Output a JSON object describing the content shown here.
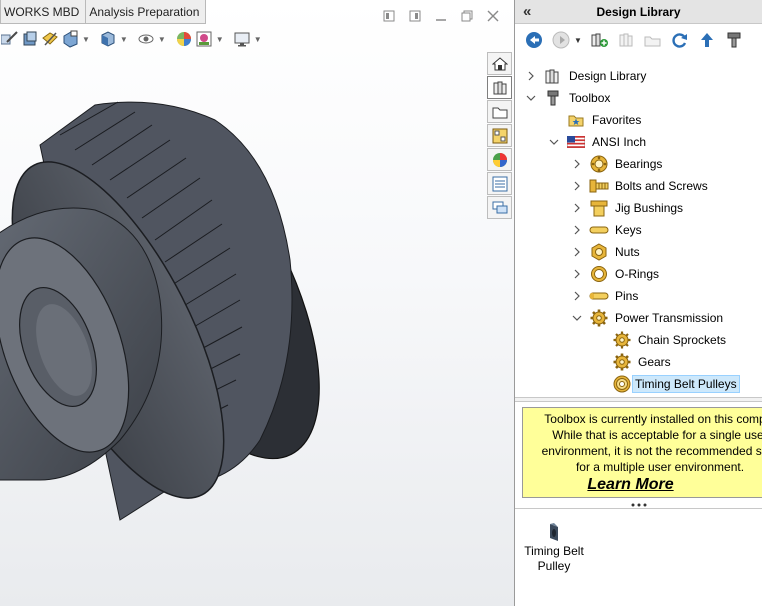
{
  "tabs": [
    {
      "label": "WORKS MBD"
    },
    {
      "label": "Analysis Preparation"
    }
  ],
  "window_controls": [
    "restore-icon",
    "restore-down-icon",
    "maximize-icon",
    "close-icon"
  ],
  "heads_up_toolbar": [
    "zoom-to-area-icon",
    "previous-view-icon",
    "section-view-icon",
    "dynamic-annotation-icon",
    "view-orientation-icon",
    "display-style-icon",
    "hide-show-icon",
    "edit-appearance-icon",
    "apply-scene-icon",
    "view-settings-icon"
  ],
  "taskpane_tabs": [
    "home-icon",
    "design-library-icon",
    "file-explorer-icon",
    "view-palette-icon",
    "appearances-icon",
    "custom-properties-icon",
    "forum-icon"
  ],
  "design_library": {
    "title": "Design Library",
    "toolbar": [
      "back-icon",
      "forward-icon",
      "add-to-library-icon",
      "add-file-location-icon",
      "create-new-folder-icon",
      "refresh-icon",
      "up-one-level-icon",
      "toolbox-settings-icon"
    ],
    "tree": [
      {
        "label": "Design Library",
        "icon": "design-library-icon",
        "expander": "collapsed"
      },
      {
        "label": "Toolbox",
        "icon": "toolbox-icon",
        "expander": "expanded"
      },
      {
        "label": "Favorites",
        "icon": "favorites-star-icon",
        "expander": "none"
      },
      {
        "label": "ANSI Inch",
        "icon": "us-flag-icon",
        "expander": "expanded"
      },
      {
        "label": "Bearings",
        "icon": "bearing-icon",
        "expander": "collapsed"
      },
      {
        "label": "Bolts and Screws",
        "icon": "bolt-icon",
        "expander": "collapsed"
      },
      {
        "label": "Jig Bushings",
        "icon": "jig-bushing-icon",
        "expander": "collapsed"
      },
      {
        "label": "Keys",
        "icon": "key-icon",
        "expander": "collapsed"
      },
      {
        "label": "Nuts",
        "icon": "nut-icon",
        "expander": "collapsed"
      },
      {
        "label": "O-Rings",
        "icon": "o-ring-icon",
        "expander": "collapsed"
      },
      {
        "label": "Pins",
        "icon": "pin-icon",
        "expander": "collapsed"
      },
      {
        "label": "Power Transmission",
        "icon": "gear-icon",
        "expander": "expanded"
      },
      {
        "label": "Chain Sprockets",
        "icon": "sprocket-icon",
        "expander": "none"
      },
      {
        "label": "Gears",
        "icon": "gear-icon",
        "expander": "none"
      },
      {
        "label": "Timing Belt Pulleys",
        "icon": "pulley-icon",
        "expander": "none",
        "selected": true
      }
    ],
    "note": {
      "text": "Toolbox is currently installed on this comput\nWhile that is acceptable for a single user\nenvironment, it is not the recommended setu\nfor a multiple user environment.",
      "link": "Learn More",
      "background": "#ffff99"
    },
    "files": [
      {
        "label": "Timing Belt Pulley",
        "icon": "timing-belt-pulley-part-icon"
      }
    ]
  },
  "colors": {
    "selection_bg": "#cde8fb",
    "note_bg": "#ffff99",
    "model_body": "#4a4e56"
  }
}
